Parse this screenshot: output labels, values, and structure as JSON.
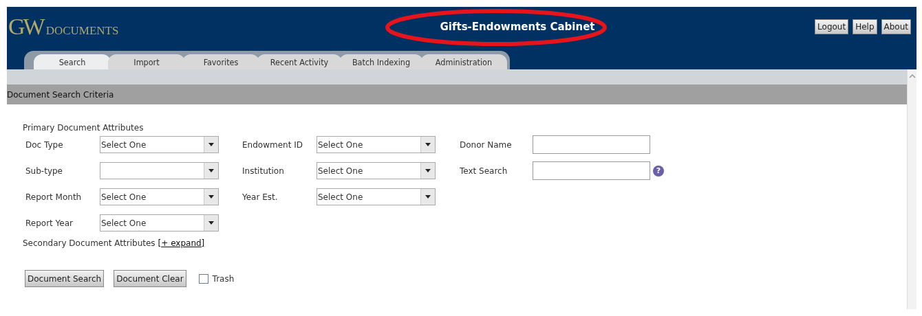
{
  "header": {
    "logo_initials": "GW",
    "logo_word": "DOCUMENTS",
    "title": "Gifts-Endowments Cabinet",
    "buttons": [
      "Logout",
      "Help",
      "About"
    ]
  },
  "annotation": {
    "kind": "ellipse",
    "color": "#e8141b"
  },
  "tabs": [
    {
      "label": "Search",
      "selected": true
    },
    {
      "label": "Import",
      "selected": false
    },
    {
      "label": "Favorites",
      "selected": false
    },
    {
      "label": "Recent Activity",
      "selected": false
    },
    {
      "label": "Batch Indexing",
      "selected": false
    },
    {
      "label": "Administration",
      "selected": false
    }
  ],
  "section_title": "Document Search Criteria",
  "primary": {
    "heading": "Primary Document Attributes",
    "columns": [
      [
        {
          "kind": "select",
          "label": "Doc Type",
          "value": "Select One"
        },
        {
          "kind": "select",
          "label": "Sub-type"
        },
        {
          "kind": "select",
          "label": "Report Month",
          "value": "Select One"
        },
        {
          "kind": "select",
          "label": "Report Year",
          "value": "Select One"
        }
      ],
      [
        {
          "kind": "select",
          "label": "Endowment ID",
          "value": "Select One"
        },
        {
          "kind": "select",
          "label": "Institution",
          "value": "Select One"
        },
        {
          "kind": "select",
          "label": "Year Est.",
          "value": "Select One"
        }
      ],
      [
        {
          "kind": "text",
          "label": "Donor Name"
        },
        {
          "kind": "text",
          "label": "Text Search",
          "help": "?"
        }
      ]
    ]
  },
  "secondary": {
    "heading": "Secondary Document Attributes",
    "link": "[+ expand]"
  },
  "actions": [
    {
      "label": "Document Search"
    },
    {
      "label": "Document Clear"
    }
  ],
  "trash": {
    "label": "Trash",
    "checked": false
  }
}
